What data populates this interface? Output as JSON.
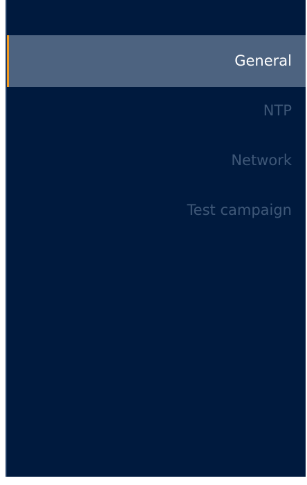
{
  "sidebar": {
    "items": [
      {
        "label": "General",
        "active": true
      },
      {
        "label": "NTP",
        "active": false
      },
      {
        "label": "Network",
        "active": false
      },
      {
        "label": "Test campaign",
        "active": false
      }
    ]
  },
  "colors": {
    "background": "#001a3e",
    "active_background": "#4d6380",
    "active_accent": "#f39a1e",
    "inactive_text": "#3f5878",
    "active_text": "#ffffff"
  }
}
